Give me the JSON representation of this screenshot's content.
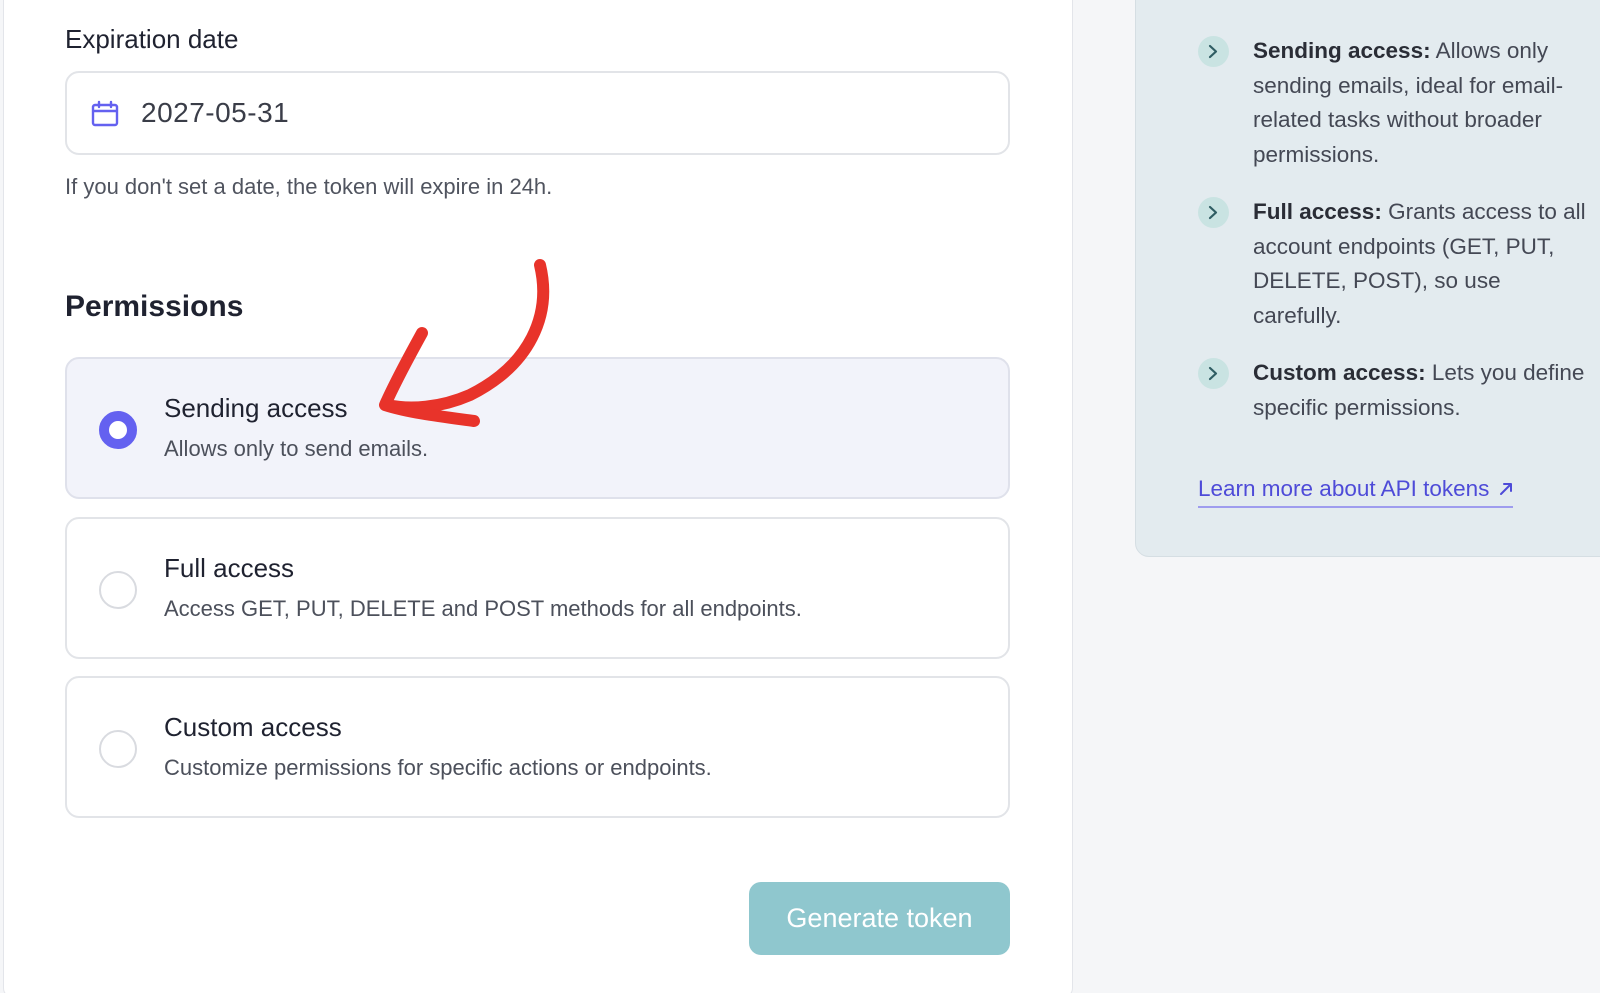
{
  "expiration": {
    "label": "Expiration date",
    "value": "2027-05-31",
    "hint": "If you don't set a date, the token will expire in 24h.",
    "icon": "calendar-icon"
  },
  "permissions": {
    "title": "Permissions",
    "selected": "sending",
    "options": [
      {
        "title": "Sending access",
        "description": "Allows only to send emails."
      },
      {
        "title": "Full access",
        "description": "Access GET, PUT, DELETE and POST methods for all endpoints."
      },
      {
        "title": "Custom access",
        "description": "Customize permissions for specific actions or endpoints."
      }
    ]
  },
  "generate_button": "Generate token",
  "info": {
    "items": [
      {
        "term": "Sending access:",
        "text": " Allows only sending emails, ideal for email-related tasks without broader permissions."
      },
      {
        "term": "Full access:",
        "text": " Grants access to all account endpoints (GET, PUT, DELETE, POST), so use carefully."
      },
      {
        "term": "Custom access:",
        "text": " Lets you define specific permissions."
      }
    ],
    "learn_more": "Learn more about API tokens"
  },
  "colors": {
    "accent": "#6461f0",
    "button_bg": "#8fc7ce",
    "info_bg": "#e3ebef",
    "annotation_arrow": "#e8332a",
    "link": "#4e4bd8"
  }
}
